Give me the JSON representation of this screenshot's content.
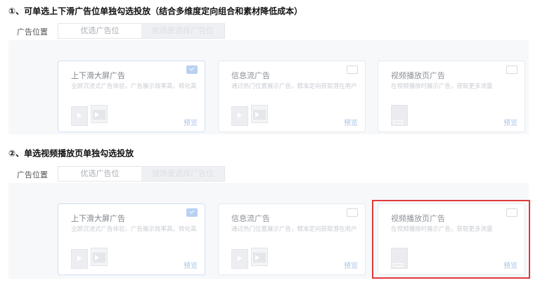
{
  "sections": [
    {
      "heading": "①、可单选上下滑广告位单独勾选投放（结合多维度定向组合和素材降低成本）",
      "position_label": "广告位置",
      "segments": [
        "优选广告位",
        "按场景选择广告位"
      ],
      "cards": [
        {
          "title": "上下滑大屏广告",
          "desc": "全屏沉浸式广告体验，广告展示效率高，转化高",
          "preview": "预览",
          "checked": true
        },
        {
          "title": "信息流广告",
          "desc": "通过热门位置展示广告，精准定向获取潜在用户",
          "preview": "预览",
          "checked": false
        },
        {
          "title": "视频播放页广告",
          "desc": "在视频播放时展示广告，获取更多流量",
          "preview": "预览",
          "checked": false
        }
      ]
    },
    {
      "heading": "②、单选视频播放页单独勾选投放",
      "position_label": "广告位置",
      "segments": [
        "优选广告位",
        "按场景选择广告位"
      ],
      "cards": [
        {
          "title": "上下滑大屏广告",
          "desc": "全屏沉浸式广告体验，广告展示效率高，转化高",
          "preview": "预览",
          "checked": true
        },
        {
          "title": "信息流广告",
          "desc": "通过热门位置展示广告，精准定向获取潜在用户",
          "preview": "预览",
          "checked": false
        },
        {
          "title": "视频播放页广告",
          "desc": "在视频播放时展示广告，获取更多流量",
          "preview": "预览",
          "checked": false
        }
      ]
    }
  ],
  "colors": {
    "highlight": "#e03a3a",
    "checked_box": "#b8d1f3"
  }
}
